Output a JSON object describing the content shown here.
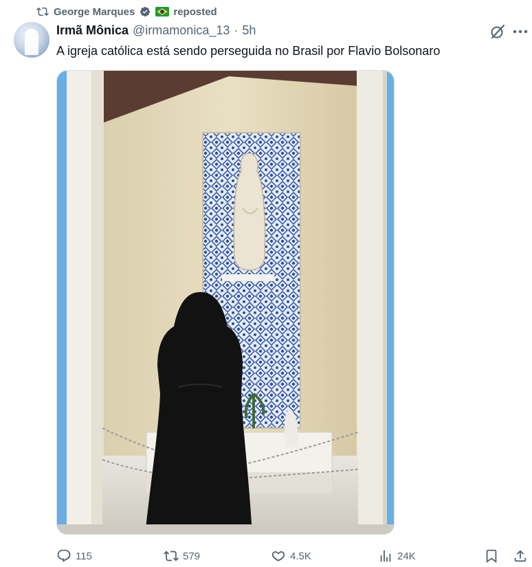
{
  "repost": {
    "reposter_name": "George Marques",
    "reposted_label": "reposted",
    "icon": "repost-icon"
  },
  "author": {
    "display_name": "Irmã Mônica",
    "handle": "@irmamonica_13",
    "separator": "·",
    "time": "5h"
  },
  "post": {
    "text": "A igreja católica está sendo perseguida no Brasil por Flavio Bolsonaro"
  },
  "actions": {
    "replies": "115",
    "reposts": "579",
    "likes": "4.5K",
    "views": "24K"
  },
  "colors": {
    "secondary_text": "#536471",
    "primary_text": "#0f1419",
    "verified_blue": "#1d9bf0",
    "shrine_blue_wall": "#6aaee6",
    "tile_blue": "#3b5fae"
  }
}
